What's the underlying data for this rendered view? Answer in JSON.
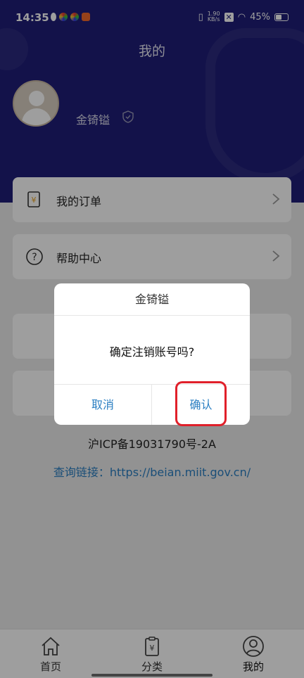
{
  "status_bar": {
    "time": "14:35",
    "net_speed_value": "1.90",
    "net_speed_unit": "KB/s",
    "battery": "45%",
    "battery_level": 0.45
  },
  "header": {
    "title": "我的",
    "username": "金锜镒"
  },
  "menu": [
    {
      "label": "我的订单",
      "icon": "order-receipt-icon"
    },
    {
      "label": "帮助中心",
      "icon": "help-question-icon"
    }
  ],
  "footer": {
    "icp": "沪ICP备19031790号-2A",
    "query_link": "查询链接：https://beian.miit.gov.cn/"
  },
  "bottom_nav": [
    {
      "label": "首页",
      "icon": "home-icon"
    },
    {
      "label": "分类",
      "icon": "category-clipboard-icon"
    },
    {
      "label": "我的",
      "icon": "user-icon"
    }
  ],
  "dialog": {
    "title": "金锜镒",
    "message": "确定注销账号吗?",
    "cancel_label": "取消",
    "confirm_label": "确认"
  },
  "colors": {
    "header_bg": "#1f1e78",
    "link": "#2b7fc2",
    "highlight": "#e0202a"
  }
}
